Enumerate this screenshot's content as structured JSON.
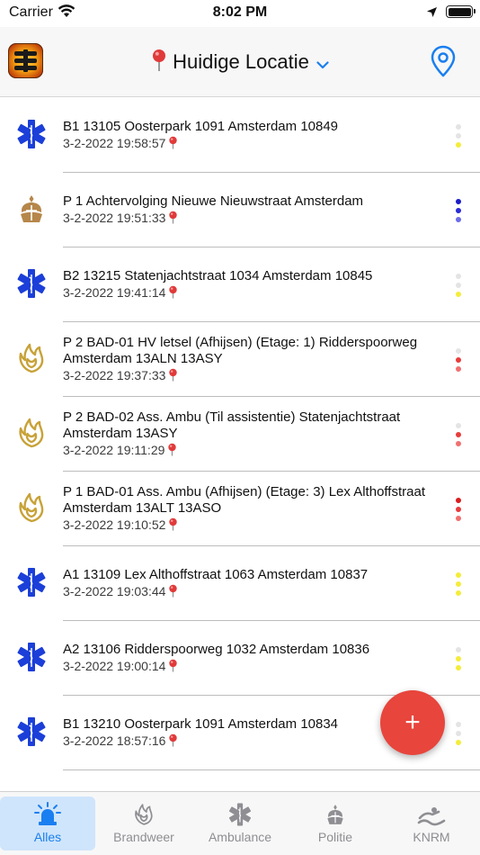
{
  "status_bar": {
    "carrier": "Carrier",
    "time": "8:02 PM"
  },
  "header": {
    "location_title": "Huidige Locatie"
  },
  "incidents": [
    {
      "service": "ambulance",
      "title": "B1 13105 Oosterpark 1091 Amsterdam 10849",
      "datetime": "3-2-2022 19:58:57",
      "dots": [
        "#e4e4e4",
        "#e4e4e4",
        "#f5ec3a"
      ]
    },
    {
      "service": "politie",
      "title": "P 1 Achtervolging Nieuwe Nieuwstraat Amsterdam",
      "datetime": "3-2-2022 19:51:33",
      "dots": [
        "#1c1cc8",
        "#2a2ad8",
        "#6b6bea"
      ]
    },
    {
      "service": "ambulance",
      "title": "B2 13215 Statenjachtstraat 1034 Amsterdam 10845",
      "datetime": "3-2-2022 19:41:14",
      "dots": [
        "#e4e4e4",
        "#e4e4e4",
        "#f5ec3a"
      ]
    },
    {
      "service": "brandweer",
      "title": "P 2 BAD-01 HV letsel (Afhijsen) (Etage: 1) Ridderspoorweg Amsterdam 13ALN 13ASY",
      "datetime": "3-2-2022 19:37:33",
      "dots": [
        "#e4e4e4",
        "#e83c3c",
        "#f07070"
      ]
    },
    {
      "service": "brandweer",
      "title": "P 2 BAD-02 Ass. Ambu (Til assistentie) Statenjachtstraat Amsterdam 13ASY",
      "datetime": "3-2-2022 19:11:29",
      "dots": [
        "#e4e4e4",
        "#e83c3c",
        "#f07070"
      ]
    },
    {
      "service": "brandweer",
      "title": "P 1 BAD-01 Ass. Ambu (Afhijsen) (Etage: 3) Lex Althoffstraat Amsterdam 13ALT 13ASO",
      "datetime": "3-2-2022 19:10:52",
      "dots": [
        "#d81e1e",
        "#e83c3c",
        "#f07070"
      ]
    },
    {
      "service": "ambulance",
      "title": "A1 13109 Lex Althoffstraat 1063 Amsterdam 10837",
      "datetime": "3-2-2022 19:03:44",
      "dots": [
        "#f5ec3a",
        "#f5ec3a",
        "#f5ec3a"
      ]
    },
    {
      "service": "ambulance",
      "title": "A2 13106 Ridderspoorweg 1032 Amsterdam 10836",
      "datetime": "3-2-2022 19:00:14",
      "dots": [
        "#e4e4e4",
        "#f5ec3a",
        "#f5ec3a"
      ]
    },
    {
      "service": "ambulance",
      "title": "B1 13210 Oosterpark 1091 Amsterdam 10834",
      "datetime": "3-2-2022 18:57:16",
      "dots": [
        "#e4e4e4",
        "#e4e4e4",
        "#f5ec3a"
      ]
    }
  ],
  "fab": {
    "label": "+"
  },
  "tabs": [
    {
      "label": "Alles",
      "icon": "siren-icon",
      "active": true
    },
    {
      "label": "Brandweer",
      "icon": "brandweer-icon",
      "active": false
    },
    {
      "label": "Ambulance",
      "icon": "star-of-life-icon",
      "active": false
    },
    {
      "label": "Politie",
      "icon": "politie-icon",
      "active": false
    },
    {
      "label": "KNRM",
      "icon": "knrm-icon",
      "active": false
    }
  ],
  "colors": {
    "accent": "#1a7ff0",
    "fab": "#e8453c",
    "ambulance": "#1b3fd8",
    "brandweer": "#c8a238",
    "politie": "#b6874a"
  }
}
